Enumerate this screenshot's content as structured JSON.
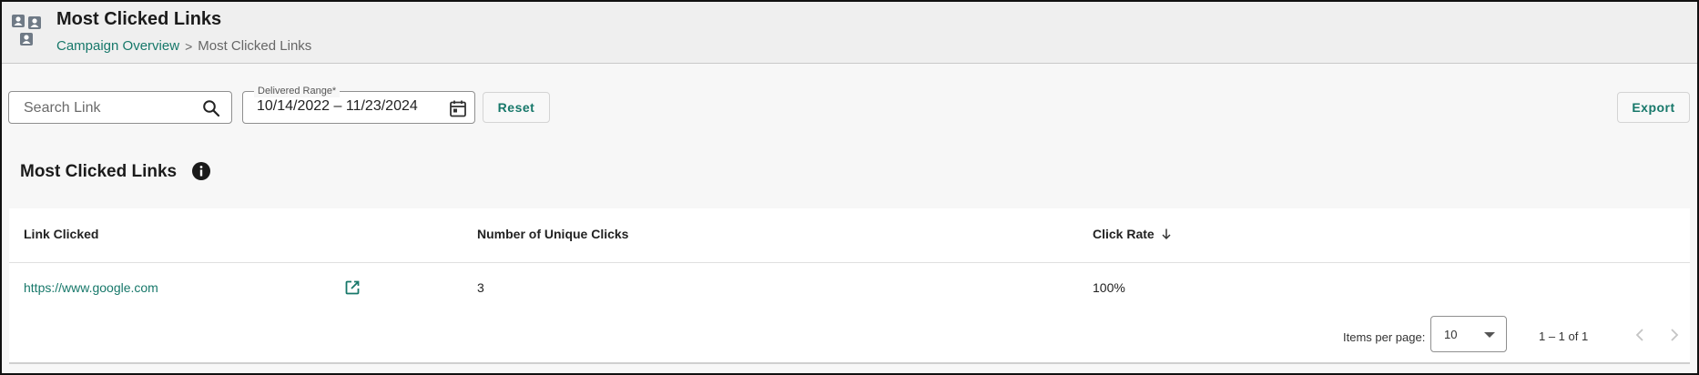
{
  "header": {
    "title": "Most Clicked Links",
    "icon": "contacts-group-icon",
    "breadcrumb": {
      "parent": "Campaign Overview",
      "separator": ">",
      "current": "Most Clicked Links"
    }
  },
  "toolbar": {
    "search": {
      "placeholder": "Search Link",
      "value": ""
    },
    "date_range": {
      "label": "Delivered Range*",
      "value": "10/14/2022 – 11/23/2024"
    },
    "reset_label": "Reset",
    "export_label": "Export"
  },
  "section": {
    "title": "Most Clicked Links",
    "info_icon": "info-icon"
  },
  "table": {
    "columns": [
      "Link Clicked",
      "Number of Unique Clicks",
      "Click Rate"
    ],
    "sort": {
      "column": "Click Rate",
      "direction": "descending"
    },
    "rows": [
      {
        "link": "https://www.google.com",
        "unique_clicks": "3",
        "click_rate": "100%"
      }
    ]
  },
  "pagination": {
    "items_per_page_label": "Items per page:",
    "items_per_page": "10",
    "range": "1 – 1 of 1"
  },
  "colors": {
    "accent": "#17786a",
    "header_bg": "#efefef",
    "page_bg": "#f7f7f7"
  }
}
